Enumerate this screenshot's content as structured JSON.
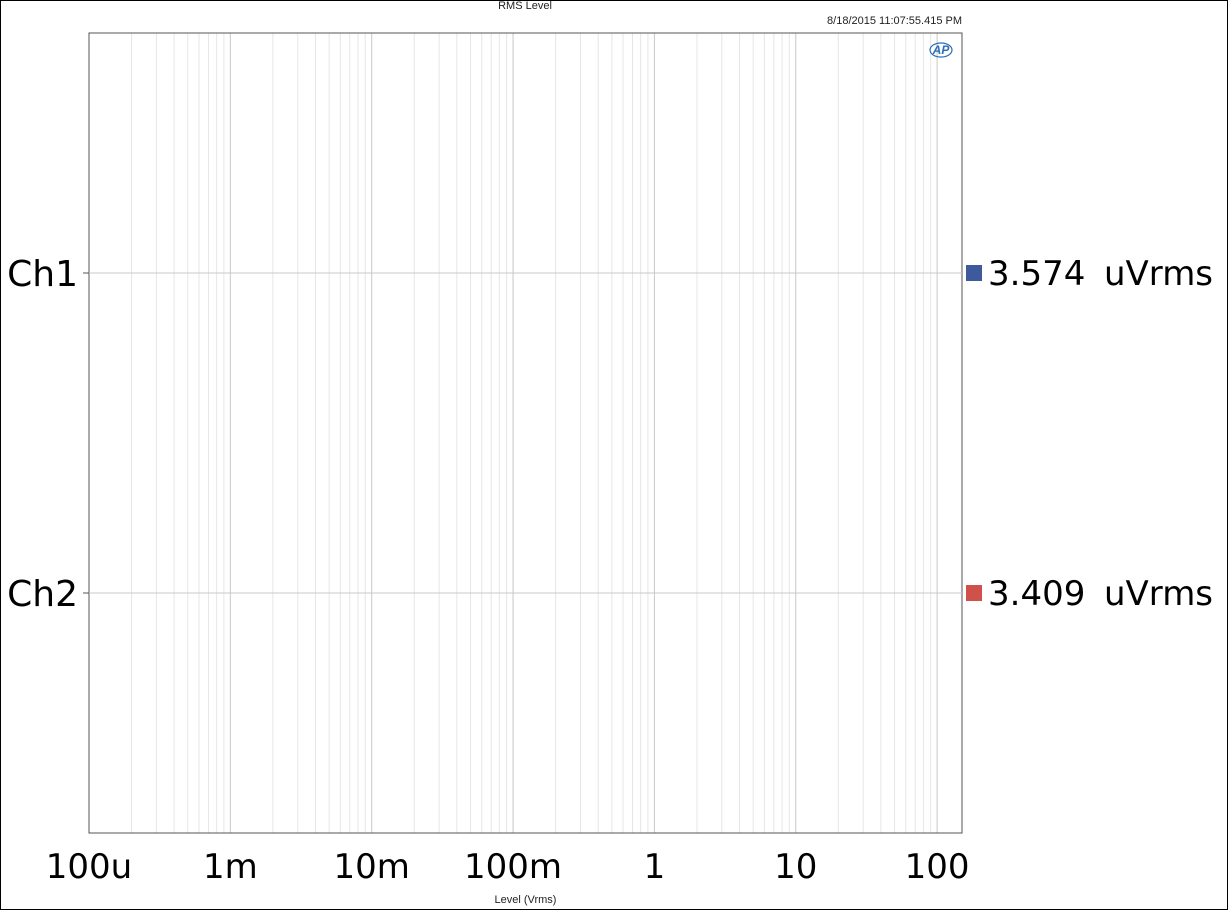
{
  "chart_data": {
    "type": "bar",
    "title": "RMS Level",
    "timestamp": "8/18/2015 11:07:55.415 PM",
    "xlabel": "Level (Vrms)",
    "xscale": "log",
    "xlim": [
      0.0001,
      150
    ],
    "xticks": [
      {
        "value": 0.0001,
        "label": "100u"
      },
      {
        "value": 0.001,
        "label": "1m"
      },
      {
        "value": 0.01,
        "label": "10m"
      },
      {
        "value": 0.1,
        "label": "100m"
      },
      {
        "value": 1,
        "label": "1"
      },
      {
        "value": 10,
        "label": "10"
      },
      {
        "value": 100,
        "label": "100"
      }
    ],
    "grid": true,
    "categories": [
      "Ch1",
      "Ch2"
    ],
    "series": [
      {
        "name": "Ch1",
        "value": 3.574e-06,
        "readout_value": "3.574",
        "readout_unit": "uVrms",
        "color": "#3f5a9c"
      },
      {
        "name": "Ch2",
        "value": 3.409e-06,
        "readout_value": "3.409",
        "readout_unit": "uVrms",
        "color": "#d0504b"
      }
    ],
    "logo": "AP"
  }
}
